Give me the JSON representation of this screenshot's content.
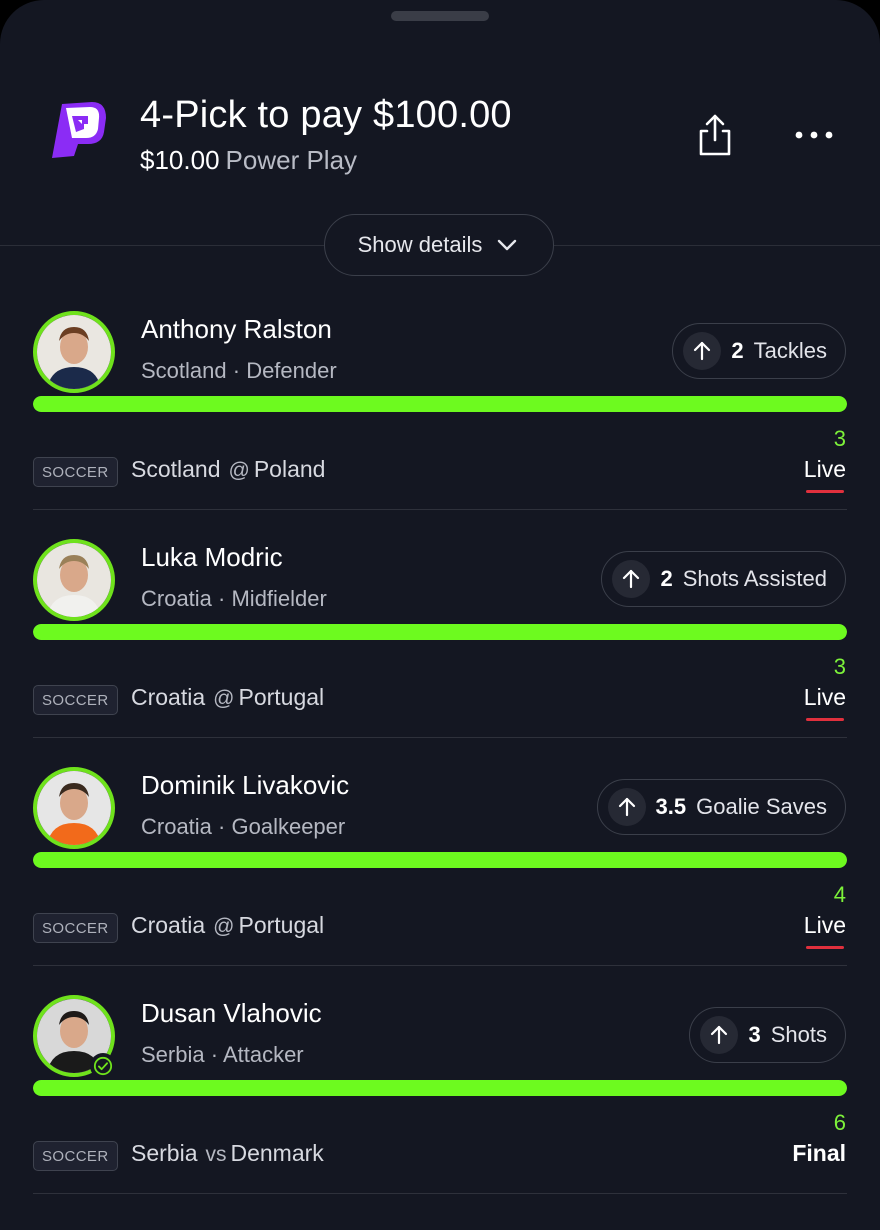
{
  "header": {
    "title": "4-Pick to pay $100.00",
    "entry_amount": "$10.00",
    "play_type": "Power Play",
    "details_label": "Show details",
    "logo_icon": "prizepicks-logo",
    "share_icon": "share-icon",
    "more_icon": "more-options-icon"
  },
  "colors": {
    "background": "#141722",
    "progress": "#6dfa1f",
    "current_value": "#7df23a",
    "live_underline": "#e0303d",
    "avatar_ring": "#6fe21c"
  },
  "picks": [
    {
      "name": "Anthony Ralston",
      "team": "Scotland",
      "position": "Defender",
      "line": "2",
      "stat": "Tackles",
      "direction": "more",
      "current": "3",
      "progress": 1.0,
      "sport": "SOCCER",
      "home": "Scotland",
      "separator": "@",
      "away": "Poland",
      "status": "Live"
    },
    {
      "name": "Luka Modric",
      "team": "Croatia",
      "position": "Midfielder",
      "line": "2",
      "stat": "Shots Assisted",
      "direction": "more",
      "current": "3",
      "progress": 1.0,
      "sport": "SOCCER",
      "home": "Croatia",
      "separator": "@",
      "away": "Portugal",
      "status": "Live"
    },
    {
      "name": "Dominik Livakovic",
      "team": "Croatia",
      "position": "Goalkeeper",
      "line": "3.5",
      "stat": "Goalie Saves",
      "direction": "more",
      "current": "4",
      "progress": 1.0,
      "sport": "SOCCER",
      "home": "Croatia",
      "separator": "@",
      "away": "Portugal",
      "status": "Live"
    },
    {
      "name": "Dusan Vlahovic",
      "team": "Serbia",
      "position": "Attacker",
      "line": "3",
      "stat": "Shots",
      "direction": "more",
      "current": "6",
      "progress": 1.0,
      "sport": "SOCCER",
      "home": "Serbia",
      "separator": "vs",
      "away": "Denmark",
      "status": "Final",
      "verified": true
    }
  ]
}
